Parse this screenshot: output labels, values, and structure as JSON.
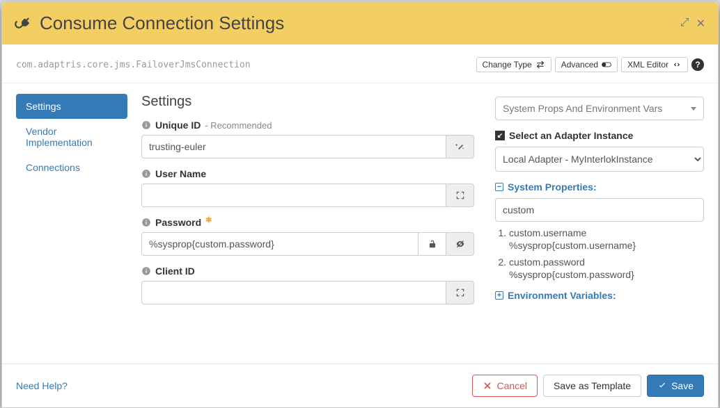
{
  "header": {
    "title": "Consume Connection Settings"
  },
  "subheader": {
    "classname": "com.adaptris.core.jms.FailoverJmsConnection",
    "change_type": "Change Type",
    "advanced": "Advanced",
    "xml_editor": "XML Editor"
  },
  "sidenav": {
    "items": [
      "Settings",
      "Vendor Implementation",
      "Connections"
    ],
    "active_index": 0
  },
  "settings": {
    "heading": "Settings",
    "unique_id_label": "Unique ID",
    "unique_id_hint": "- Recommended",
    "unique_id_value": "trusting-euler",
    "username_label": "User Name",
    "username_value": "",
    "password_label": "Password",
    "password_value": "%sysprop{custom.password}",
    "client_id_label": "Client ID",
    "client_id_value": ""
  },
  "rightcol": {
    "top_select": "System Props And Environment Vars",
    "adapter_label": "Select an Adapter Instance",
    "adapter_value": "Local Adapter - MyInterlokInstance",
    "sys_props_label": "System Properties:",
    "filter_value": "custom",
    "props": [
      {
        "name": "custom.username",
        "expr": "%sysprop{custom.username}"
      },
      {
        "name": "custom.password",
        "expr": "%sysprop{custom.password}"
      }
    ],
    "env_vars_label": "Environment Variables:"
  },
  "footer": {
    "help": "Need Help?",
    "cancel": "Cancel",
    "save_template": "Save as Template",
    "save": "Save"
  }
}
